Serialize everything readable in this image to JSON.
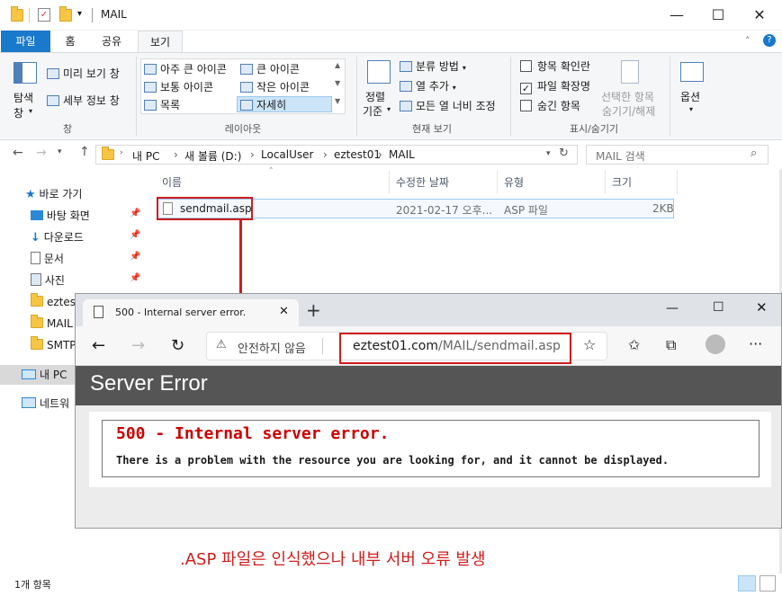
{
  "explorer": {
    "title": "MAIL",
    "tabs": {
      "file": "파일",
      "home": "홈",
      "share": "공유",
      "view": "보기"
    },
    "ribbon": {
      "nav_pane": "탐색\n창",
      "nav_pane_l1": "탐색",
      "nav_pane_l2": "창",
      "preview_pane": "미리 보기 창",
      "details_pane": "세부 정보 창",
      "pane_group": "창",
      "layout_items": [
        "아주 큰 아이콘",
        "큰 아이콘",
        "보통 아이콘",
        "작은 아이콘",
        "목록",
        "자세히"
      ],
      "layout_group": "레이아웃",
      "sort_l1": "정렬",
      "sort_l2": "기준",
      "group_by": "분류 방법",
      "add_columns": "열 추가",
      "fit_columns": "모든 열 너비 조정",
      "current_view_group": "현재 보기",
      "item_checkboxes": "항목 확인란",
      "file_extensions": "파일 확장명",
      "hidden_items": "숨긴 항목",
      "hide_selected_l1": "선택한 항목",
      "hide_selected_l2": "숨기기/해제",
      "show_hide_group": "표시/숨기기",
      "options": "옵션"
    },
    "address": {
      "path": [
        "내 PC",
        "새 볼륨 (D:)",
        "LocalUser",
        "eztest01",
        "MAIL"
      ],
      "search_placeholder": "MAIL 검색"
    },
    "nav": {
      "quick_access": "바로 가기",
      "desktop": "바탕 화면",
      "downloads": "다운로드",
      "documents": "문서",
      "pictures": "사진",
      "eztest": "eztes",
      "mail": "MAIL",
      "smtp": "SMTP",
      "this_pc": "내 PC",
      "network": "네트워"
    },
    "columns": {
      "name": "이름",
      "modified": "수정한 날짜",
      "type": "유형",
      "size": "크기"
    },
    "files": [
      {
        "name": "sendmail.asp",
        "modified": "2021-02-17 오후...",
        "type": "ASP 파일",
        "size": "2KB"
      }
    ],
    "status": "1개 항목"
  },
  "browser": {
    "tab_title": "500 - Internal server error.",
    "security_text": "안전하지 않음",
    "url_host": "eztest01.com",
    "url_path": "/MAIL/sendmail.asp",
    "page": {
      "header": "Server Error",
      "error_title": "500 - Internal server error.",
      "error_message": "There is a problem with the resource you are looking for, and it cannot be displayed."
    }
  },
  "annotation": {
    "text": ".ASP 파일은 인식했으나 내부 서버 오류 발생",
    "color": "#d01c1c"
  }
}
